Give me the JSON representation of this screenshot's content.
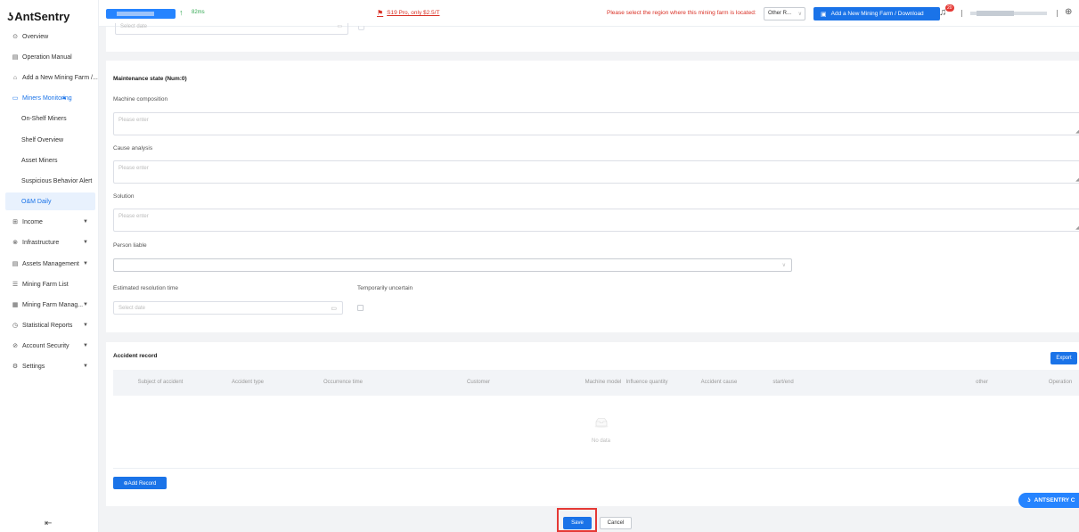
{
  "app": {
    "logo_text": "AntSentry"
  },
  "sidebar": {
    "items": [
      {
        "icon": "overview-icon",
        "glyph": "⊙",
        "label": "Overview"
      },
      {
        "icon": "manual-icon",
        "glyph": "▤",
        "label": "Operation Manual"
      },
      {
        "icon": "farm-icon",
        "glyph": "⌂",
        "label": "Add a New Mining Farm /..."
      },
      {
        "icon": "monitor-icon",
        "glyph": "▭",
        "label": "Miners Monitoring"
      },
      {
        "label": "On-Shelf Miners"
      },
      {
        "label": "Shelf Overview"
      },
      {
        "label": "Asset Miners"
      },
      {
        "label": "Suspicious Behavior Alert"
      },
      {
        "label": "O&M Daily"
      },
      {
        "icon": "income-icon",
        "glyph": "⊞",
        "label": "Income"
      },
      {
        "icon": "infrastructure-icon",
        "glyph": "⊗",
        "label": "Infrastructure"
      },
      {
        "icon": "assets-icon",
        "glyph": "▤",
        "label": "Assets Management"
      },
      {
        "icon": "list-icon",
        "glyph": "☰",
        "label": "Mining Farm List"
      },
      {
        "icon": "farm-manage-icon",
        "glyph": "▦",
        "label": "Mining Farm Manag..."
      },
      {
        "icon": "reports-icon",
        "glyph": "◷",
        "label": "Statistical Reports"
      },
      {
        "icon": "security-icon",
        "glyph": "⊘",
        "label": "Account Security"
      },
      {
        "icon": "settings-icon",
        "glyph": "⚙",
        "label": "Settings"
      }
    ]
  },
  "topbar": {
    "latency": "82ms",
    "promo": "S19 Pro, only $2.5/T",
    "region_message": "Please select the region where this mining farm is located:",
    "region_value": "Other R...",
    "add_farm_label": "Add a New Mining Farm / Download",
    "notification_count": "20"
  },
  "top_partial": {
    "date_placeholder": "Select date"
  },
  "maintenance": {
    "title": "Maintenance state (Num:0)",
    "machine_composition_label": "Machine composition",
    "machine_composition_placeholder": "Please enter",
    "cause_analysis_label": "Cause analysis",
    "cause_analysis_placeholder": "Please enter",
    "solution_label": "Solution",
    "solution_placeholder": "Please enter",
    "person_liable_label": "Person liable",
    "estimated_time_label": "Estimated resolution time",
    "estimated_time_placeholder": "Select date",
    "temporarily_uncertain_label": "Temporarily uncertain"
  },
  "accident": {
    "title": "Accident record",
    "export_label": "Export",
    "columns": [
      "Subject of accident",
      "Accident type",
      "Occurrence time",
      "Customer",
      "Machine model",
      "Influence quantity",
      "Accident cause",
      "start/end",
      "other",
      "Operation"
    ],
    "rows": [],
    "empty_text": "No data",
    "add_record_label": "⊕Add Record"
  },
  "actions": {
    "save_label": "Save",
    "cancel_label": "Cancel"
  },
  "floating": {
    "label": "ANTSENTRY C"
  },
  "colors": {
    "accent": "#1a73e8",
    "warning": "#d93025",
    "highlight": "#e53935"
  }
}
